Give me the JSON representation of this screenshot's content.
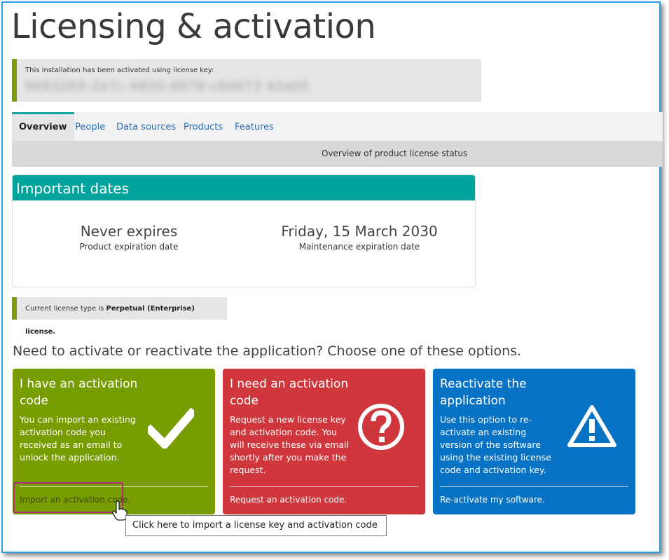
{
  "page": {
    "title": "Licensing & activation"
  },
  "activation": {
    "label": "This installation has been activated using license key:",
    "key": "9693269-2e7c-4850-8978-c60673 42a05"
  },
  "tabs": [
    {
      "label": "Overview",
      "active": true
    },
    {
      "label": "People",
      "active": false
    },
    {
      "label": "Data sources",
      "active": false
    },
    {
      "label": "Products",
      "active": false
    },
    {
      "label": "Features",
      "active": false
    }
  ],
  "overview_subtitle": "Overview of product license status",
  "dates": {
    "heading": "Important dates",
    "product": {
      "value": "Never expires",
      "label": "Product expiration date"
    },
    "maintenance": {
      "value": "Friday, 15 March 2030",
      "label": "Maintenance expiration date"
    }
  },
  "license_type": {
    "prefix": "Current license type is",
    "value": "Perpetual (Enterprise) license."
  },
  "activate": {
    "heading": "Need to activate or reactivate the application? Choose one of these options.",
    "cards": [
      {
        "title": "I have an activation code",
        "description": "You can import an existing activation code you received as an email to unlock the application.",
        "link": "Import an activation code.",
        "icon": "checkmark-icon",
        "color": "#789d03"
      },
      {
        "title": "I need an activation code",
        "description": "Request a new license key and activation code. You will receive these via email shortly after you make the request.",
        "link": "Request an activation code.",
        "icon": "question-circle-icon",
        "color": "#d0373d"
      },
      {
        "title": "Reactivate the application",
        "description": "Use this option to re-activate an existing version of the software using the existing license code and activation key.",
        "link": "Re-activate my software.",
        "icon": "warning-triangle-icon",
        "color": "#0873c5"
      }
    ]
  },
  "tooltip": "Click here to import a license key and activation code",
  "colors": {
    "accent_teal": "#00a49e",
    "border_blue": "#2b9fe0",
    "highlight": "#b02b7a"
  }
}
